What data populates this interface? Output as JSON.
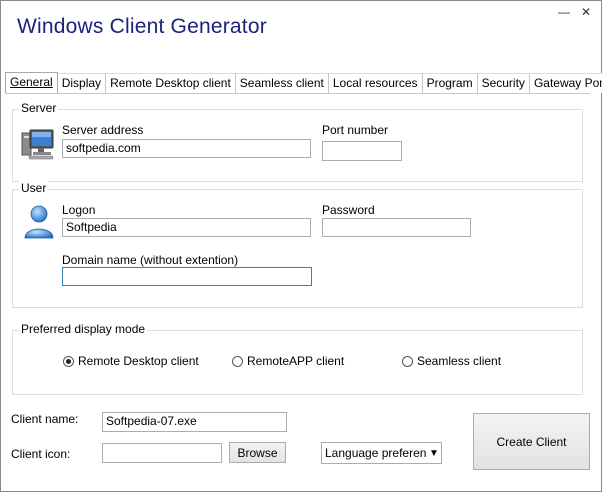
{
  "window": {
    "title": "Windows Client Generator",
    "minimize_glyph": "—",
    "close_glyph": "✕"
  },
  "tabs": [
    {
      "label": "General",
      "active": true
    },
    {
      "label": "Display"
    },
    {
      "label": "Remote Desktop client"
    },
    {
      "label": "Seamless client"
    },
    {
      "label": "Local resources"
    },
    {
      "label": "Program"
    },
    {
      "label": "Security"
    },
    {
      "label": "Gateway Portal"
    }
  ],
  "server": {
    "group_label": "Server",
    "icon": "computer-icon",
    "address_label": "Server address",
    "address_value": "softpedia.com",
    "port_label": "Port number",
    "port_value": ""
  },
  "user": {
    "group_label": "User",
    "icon": "user-icon",
    "logon_label": "Logon",
    "logon_value": "Softpedia",
    "password_label": "Password",
    "password_value": "",
    "domain_label": "Domain name (without extention)",
    "domain_value": ""
  },
  "display_mode": {
    "group_label": "Preferred display mode",
    "options": [
      {
        "label": "Remote Desktop client",
        "checked": true
      },
      {
        "label": "RemoteAPP client",
        "checked": false
      },
      {
        "label": "Seamless client",
        "checked": false
      }
    ]
  },
  "client": {
    "name_label": "Client name:",
    "name_value": "Softpedia-07.exe",
    "icon_label": "Client icon:",
    "icon_value": "",
    "browse_label": "Browse",
    "language_value": "Language preference",
    "create_label": "Create Client"
  },
  "colors": {
    "title": "#1a237e",
    "focus_border": "#3c7fb1"
  }
}
